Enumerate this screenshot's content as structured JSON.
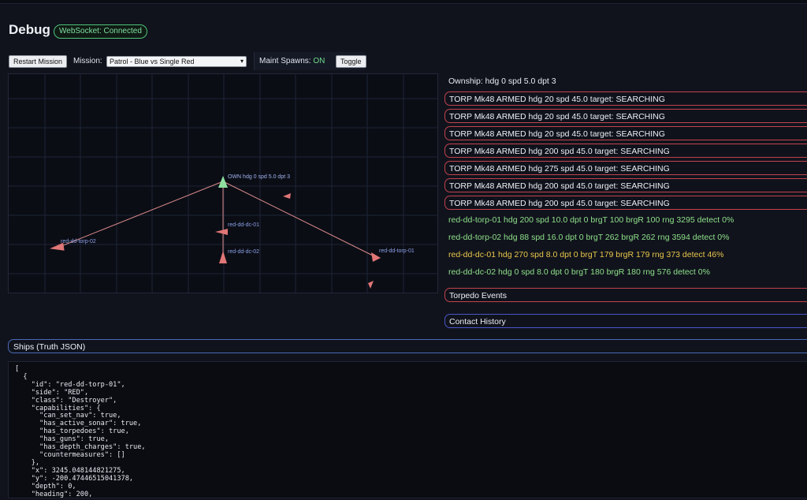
{
  "header": {
    "title": "Debug",
    "ws_status": "WebSocket: Connected"
  },
  "controls": {
    "restart_label": "Restart Mission",
    "mission_label": "Mission:",
    "mission_selected": "Patrol - Blue vs Single Red",
    "maint_label": "Maint Spawns:",
    "maint_value": "ON",
    "toggle_label": "Toggle"
  },
  "map": {
    "labels": {
      "own": "OWN hdg 0 spd 5.0 dpt 3",
      "torp02": "red-dd-torp-02",
      "torp01": "red-dd-torp-01",
      "dc01": "red-dd-dc-01",
      "dc02": "red-dd-dc-02"
    },
    "colors": {
      "own": "#8fe0a0",
      "enemy": "#e07676",
      "line": "#d98a8a",
      "grid": "#1e2536"
    }
  },
  "status": {
    "ownship": "Ownship: hdg 0 spd 5.0 dpt 3",
    "torpedoes": [
      "TORP Mk48 ARMED hdg 20 spd 45.0 target: SEARCHING",
      "TORP Mk48 ARMED hdg 20 spd 45.0 target: SEARCHING",
      "TORP Mk48 ARMED hdg 20 spd 45.0 target: SEARCHING",
      "TORP Mk48 ARMED hdg 200 spd 45.0 target: SEARCHING",
      "TORP Mk48 ARMED hdg 275 spd 45.0 target: SEARCHING",
      "TORP Mk48 ARMED hdg 200 spd 45.0 target: SEARCHING",
      "TORP Mk48 ARMED hdg 200 spd 45.0 target: SEARCHING"
    ],
    "contacts": [
      "red-dd-torp-01 hdg 200 spd 10.0 dpt 0 brgT 100 brgR 100 rng 3295 detect 0%",
      "red-dd-torp-02 hdg 88 spd 16.0 dpt 0 brgT 262 brgR 262 rng 3594 detect 0%",
      "red-dd-dc-01 hdg 270 spd 8.0 dpt 0 brgT 179 brgR 179 rng 373 detect 46%",
      "red-dd-dc-02 hdg 0 spd 8.0 dpt 0 brgT 180 brgR 180 rng 576 detect 0%"
    ],
    "torpedo_events": "Torpedo Events",
    "contact_history": "Contact History"
  },
  "ships": {
    "header": "Ships (Truth JSON)",
    "json_text": "[\n  {\n    \"id\": \"red-dd-torp-01\",\n    \"side\": \"RED\",\n    \"class\": \"Destroyer\",\n    \"capabilities\": {\n      \"can_set_nav\": true,\n      \"has_active_sonar\": true,\n      \"has_torpedoes\": true,\n      \"has_guns\": true,\n      \"has_depth_charges\": true,\n      \"countermeasures\": []\n    },\n    \"x\": 3245.048144821275,\n    \"y\": -200.47446515041378,\n    \"depth\": 0,\n    \"heading\": 200,"
  }
}
